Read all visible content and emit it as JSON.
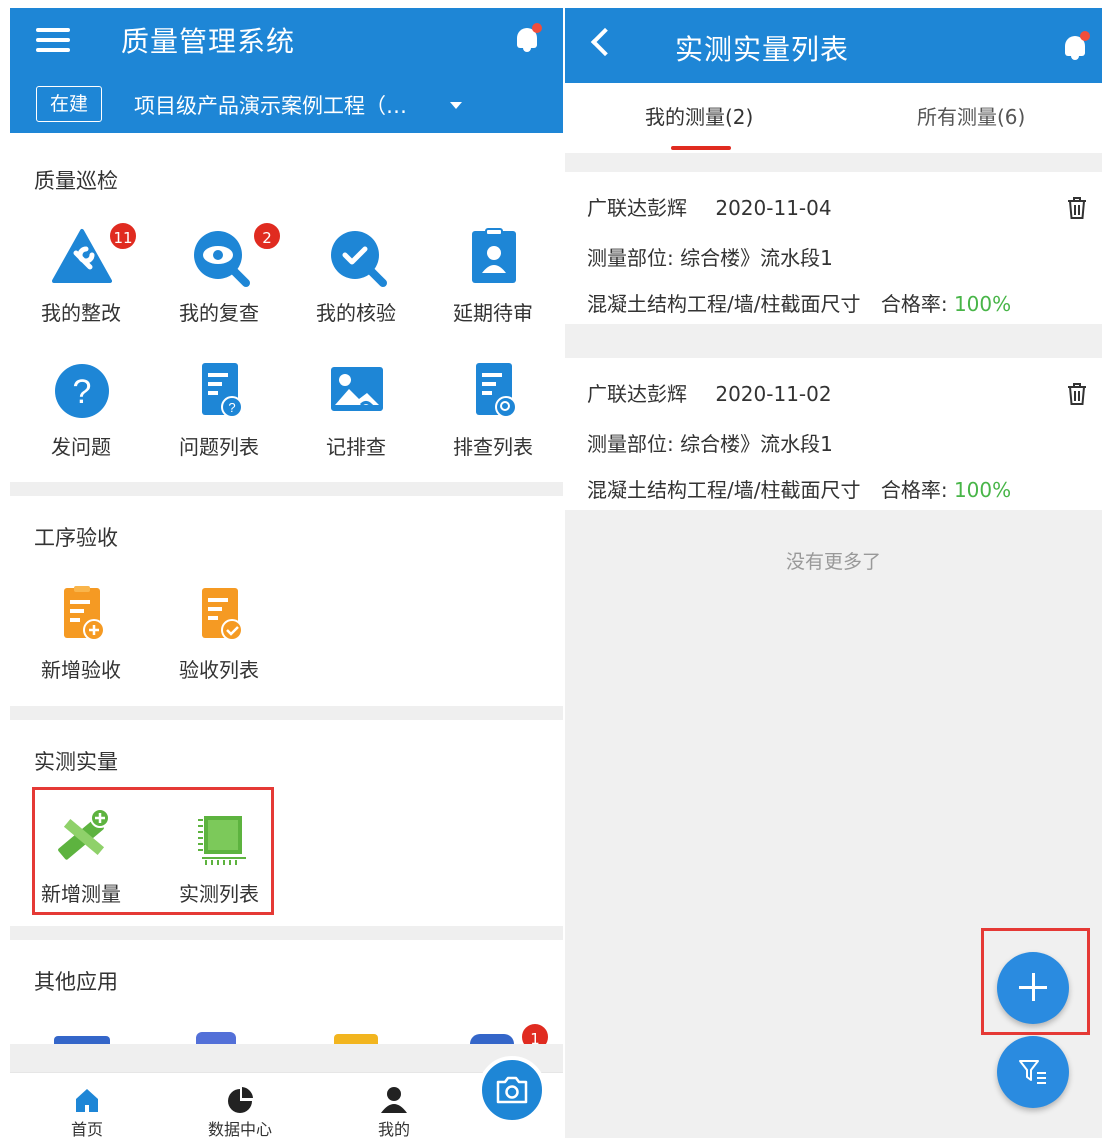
{
  "colors": {
    "brand_blue": "#1e86d6",
    "badge_red": "#e02b20",
    "highlight_red": "#e53935",
    "pass_green": "#48b548"
  },
  "left": {
    "header": {
      "title": "质量管理系统",
      "status_tag": "在建",
      "project_name": "项目级产品演示案例工程（…",
      "menu_icon": "hamburger-menu-icon",
      "bell_icon": "bell-icon"
    },
    "sections": [
      {
        "title": "质量巡检",
        "items": [
          {
            "label": "我的整改",
            "icon": "wrench-warning-icon",
            "badge": "11"
          },
          {
            "label": "我的复查",
            "icon": "eye-search-icon",
            "badge": "2"
          },
          {
            "label": "我的核验",
            "icon": "check-search-icon"
          },
          {
            "label": "延期待审",
            "icon": "id-badge-icon"
          },
          {
            "label": "发问题",
            "icon": "question-icon"
          },
          {
            "label": "问题列表",
            "icon": "document-question-icon"
          },
          {
            "label": "记排查",
            "icon": "image-wave-icon"
          },
          {
            "label": "排查列表",
            "icon": "document-search-icon"
          }
        ]
      },
      {
        "title": "工序验收",
        "items": [
          {
            "label": "新增验收",
            "icon": "document-add-icon"
          },
          {
            "label": "验收列表",
            "icon": "document-check-icon"
          }
        ]
      },
      {
        "title": "实测实量",
        "items": [
          {
            "label": "新增测量",
            "icon": "ruler-pencil-add-icon"
          },
          {
            "label": "实测列表",
            "icon": "chip-ruler-icon"
          }
        ]
      },
      {
        "title": "其他应用",
        "badge": "1"
      }
    ],
    "bottom_nav": [
      {
        "label": "首页",
        "icon": "home-icon"
      },
      {
        "label": "数据中心",
        "icon": "pie-chart-icon"
      },
      {
        "label": "我的",
        "icon": "user-icon"
      }
    ],
    "camera_icon": "camera-icon"
  },
  "right": {
    "header": {
      "title": "实测实量列表",
      "back_icon": "chevron-left-icon",
      "bell_icon": "bell-icon"
    },
    "tabs": [
      {
        "label": "我的测量(2)",
        "active": true
      },
      {
        "label": "所有测量(6)",
        "active": false
      }
    ],
    "records": [
      {
        "author": "广联达彭辉",
        "date": "2020-11-04",
        "location": "测量部位: 综合楼》流水段1",
        "item": "混凝土结构工程/墙/柱截面尺寸",
        "rate_label": "合格率:",
        "rate_value": "100%"
      },
      {
        "author": "广联达彭辉",
        "date": "2020-11-02",
        "location": "测量部位: 综合楼》流水段1",
        "item": "混凝土结构工程/墙/柱截面尺寸",
        "rate_label": "合格率:",
        "rate_value": "100%"
      }
    ],
    "no_more_text": "没有更多了",
    "add_icon": "plus-icon",
    "filter_icon": "filter-icon"
  }
}
